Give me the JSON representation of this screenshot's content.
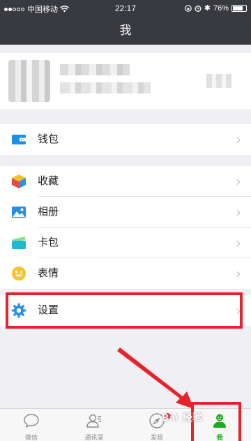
{
  "status_bar": {
    "carrier": "中国移动",
    "time": "22:17",
    "battery": "76%",
    "battery_level": 0.76
  },
  "nav": {
    "title": "我"
  },
  "menu": {
    "wallet": "钱包",
    "favorites": "收藏",
    "album": "相册",
    "cards": "卡包",
    "stickers": "表情",
    "settings": "设置"
  },
  "tabs": [
    {
      "label": "微信",
      "icon": "chat-bubble-icon"
    },
    {
      "label": "通讯录",
      "icon": "contacts-icon"
    },
    {
      "label": "发现",
      "icon": "compass-icon"
    },
    {
      "label": "我",
      "icon": "person-icon"
    }
  ],
  "watermark": "Bai 经验",
  "colors": {
    "header": "#393a3f",
    "accent_green": "#1aad19",
    "annotation_red": "#e8222b",
    "background": "#efeff4"
  }
}
